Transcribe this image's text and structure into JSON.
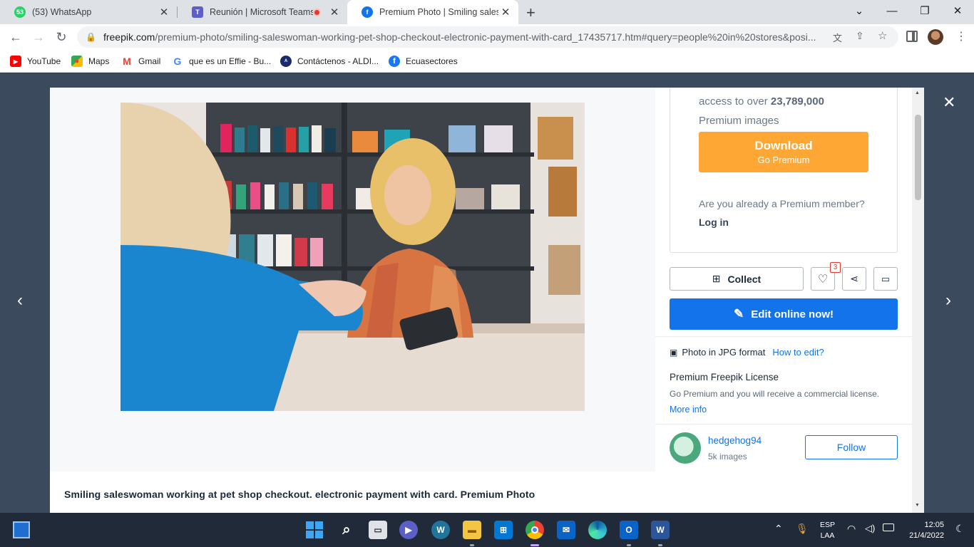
{
  "tabs": [
    {
      "title": "(53) WhatsApp",
      "badge": "53"
    },
    {
      "title": "Reunión | Microsoft Teams"
    },
    {
      "title": "Premium Photo | Smiling saleswo"
    }
  ],
  "url": {
    "host": "freepik.com",
    "path": "/premium-photo/smiling-saleswoman-working-pet-shop-checkout-electronic-payment-with-card_17435717.htm#query=people%20in%20stores&posi..."
  },
  "bookmarks": [
    {
      "label": "YouTube"
    },
    {
      "label": "Maps"
    },
    {
      "label": "Gmail"
    },
    {
      "label": "que es un Effie - Bu..."
    },
    {
      "label": "Contáctenos - ALDI..."
    },
    {
      "label": "Ecuasectores"
    }
  ],
  "sidebar": {
    "access_prefix": "access to over",
    "access_count": "23,789,000",
    "premium_images": "Premium images",
    "download_label": "Download",
    "download_sub": "Go Premium",
    "already_member": "Are you already a Premium member?",
    "login": "Log in",
    "collect": "Collect",
    "like_count": "3",
    "edit_online": "Edit online now!",
    "format": "Photo in JPG format",
    "how_to_edit": "How to edit?",
    "license_title": "Premium Freepik License",
    "license_text": "Go Premium and you will receive a commercial license.",
    "more_info": "More info",
    "author_name": "hedgehog94",
    "author_images": "5k images",
    "follow": "Follow"
  },
  "caption": "Smiling saleswoman working at pet shop checkout. electronic payment with card. Premium Photo",
  "tray": {
    "lang1": "ESP",
    "lang2": "LAA",
    "time": "12:05",
    "date": "21/4/2022"
  },
  "colors": {
    "download": "#fea735",
    "edit": "#1273eb",
    "link": "#1273eb"
  }
}
